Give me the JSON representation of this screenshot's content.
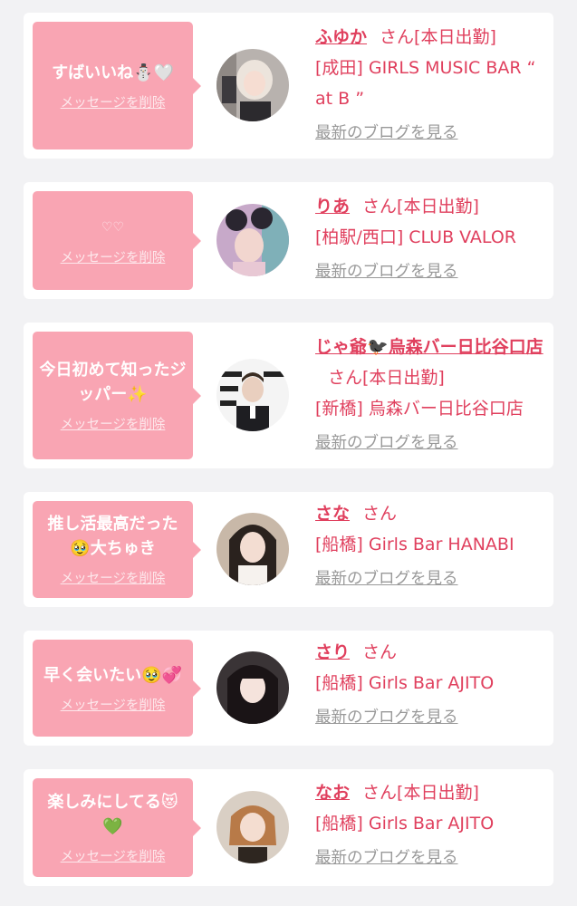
{
  "cards": [
    {
      "message": "すばいいね⛄🤍",
      "delete_label": "メッセージを削除",
      "name": "ふゆか",
      "honorific": "さん",
      "status": "[本日出勤]",
      "shop": "[成田] GIRLS MUSIC BAR “ at B ”",
      "blog_label": "最新のブログを見る"
    },
    {
      "message": "♡♡",
      "delete_label": "メッセージを削除",
      "name": "りあ",
      "honorific": "さん",
      "status": "[本日出勤]",
      "shop": "[柏駅/西口] CLUB VALOR",
      "blog_label": "最新のブログを見る"
    },
    {
      "message": "今日初めて知ったジッパー✨",
      "delete_label": "メッセージを削除",
      "name": "じゃ爺🐦‍⬛烏森バー日比谷口店",
      "honorific": "さん",
      "status": "[本日出勤]",
      "shop": "[新橋] 烏森バー日比谷口店",
      "blog_label": "最新のブログを見る"
    },
    {
      "message": "推し活最高だった🥹大ちゅき",
      "delete_label": "メッセージを削除",
      "name": "さな",
      "honorific": "さん",
      "status": "",
      "shop": "[船橋] Girls Bar HANABI",
      "blog_label": "最新のブログを見る"
    },
    {
      "message": "早く会いたい🥹💞",
      "delete_label": "メッセージを削除",
      "name": "さり",
      "honorific": "さん",
      "status": "",
      "shop": "[船橋] Girls Bar AJITO",
      "blog_label": "最新のブログを見る"
    },
    {
      "message": "楽しみにしてる😻💚",
      "delete_label": "メッセージを削除",
      "name": "なお",
      "honorific": "さん",
      "status": "[本日出勤]",
      "shop": "[船橋] Girls Bar AJITO",
      "blog_label": "最新のブログを見る"
    }
  ]
}
